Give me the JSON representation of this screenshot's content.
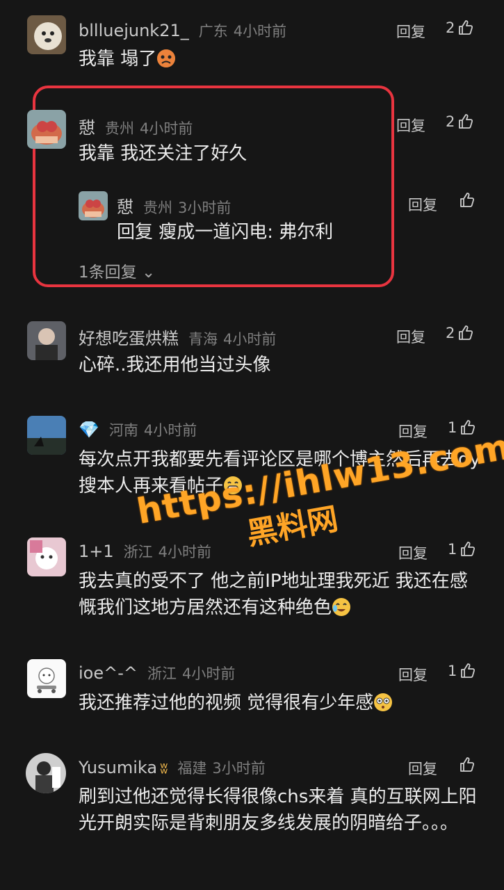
{
  "comments": [
    {
      "name": "bllluejunk21_",
      "region": "广东",
      "time": "4小时前",
      "text": "我靠 塌了",
      "likes": "2",
      "reply": "回复"
    },
    {
      "name": "憇",
      "region": "贵州",
      "time": "4小时前",
      "text": "我靠  我还关注了好久",
      "likes": "2",
      "reply": "回复",
      "sub_reply": {
        "name": "憇",
        "region": "贵州",
        "time": "3小时前",
        "text": "回复 瘦成一道闪电: 弗尔利",
        "reply": "回复"
      },
      "expand_label": "1条回复"
    },
    {
      "name": "好想吃蛋烘糕",
      "region": "青海",
      "time": "4小时前",
      "text": "心碎..我还用他当过头像",
      "likes": "2",
      "reply": "回复"
    },
    {
      "name": "",
      "region": "河南",
      "time": "4小时前",
      "text": "每次点开我都要先看评论区是哪个博主然后再去dy搜本人再来看帖子",
      "likes": "1",
      "reply": "回复"
    },
    {
      "name": "1+1",
      "region": "浙江",
      "time": "4小时前",
      "text": "我去真的受不了 他之前IP地址理我死近 我还在感慨我们这地方居然还有这种绝色",
      "likes": "1",
      "reply": "回复"
    },
    {
      "name": "ioe^-^",
      "region": "浙江",
      "time": "4小时前",
      "text": "我还推荐过他的视频  觉得很有少年感",
      "likes": "1",
      "reply": "回复"
    },
    {
      "name": "Yusumika",
      "region": "福建",
      "time": "3小时前",
      "text": "刷到过他还觉得长得很像chs来着 真的互联网上阳光开朗实际是背刺朋友多线发展的阴暗给子。。。",
      "likes": "",
      "reply": "回复"
    }
  ],
  "watermark": {
    "url": "https://ihlw13.com",
    "sub": "黑料网"
  },
  "colors": {
    "background": "#161616",
    "highlight": "#e8343f",
    "watermark": "#ffa526"
  }
}
